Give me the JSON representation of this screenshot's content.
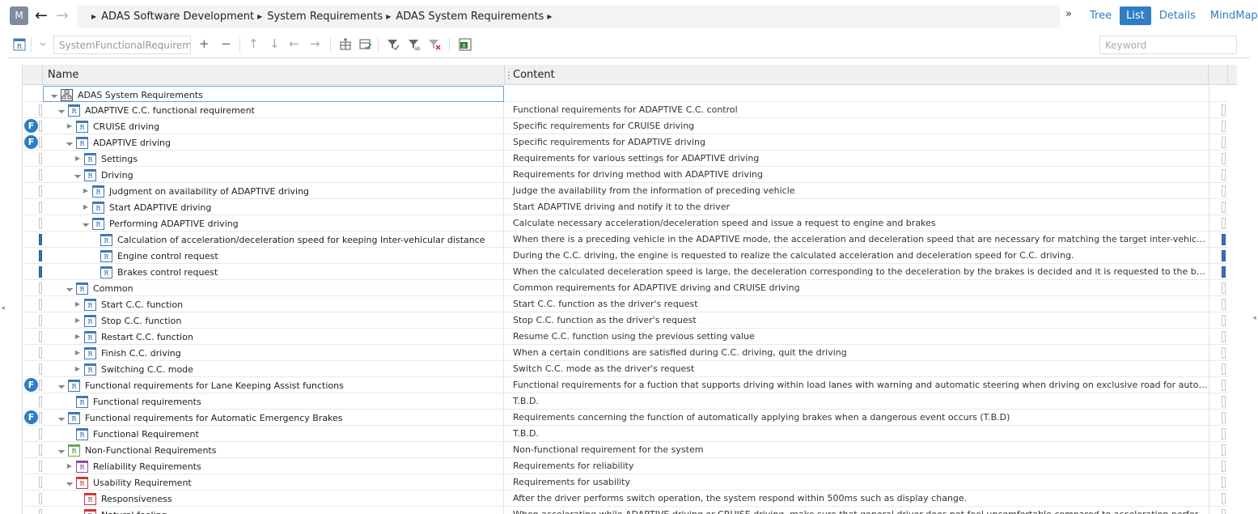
{
  "user": {
    "initial": "M"
  },
  "breadcrumb": [
    "ADAS Software Development",
    "System Requirements",
    "ADAS System Requirements"
  ],
  "more_label": "»",
  "view_tabs": [
    {
      "label": "Tree",
      "active": false
    },
    {
      "label": "List",
      "active": true
    },
    {
      "label": "Details",
      "active": false
    },
    {
      "label": "MindMap",
      "active": false
    }
  ],
  "toolbar": {
    "type_value": "SystemFunctionalRequirement",
    "keyword_placeholder": "Keyword",
    "add_label": "+",
    "remove_label": "−",
    "up_label": "↑",
    "down_label": "↓",
    "left_label": "←",
    "right_label": "→"
  },
  "columns": {
    "name": "Name",
    "content": "Content"
  },
  "accent_color": "#2f7ec4",
  "rows": [
    {
      "name": "ADAS System Requirements",
      "content": "",
      "indent": 0,
      "toggle": "open",
      "icon": "root",
      "flag": "",
      "mark": false,
      "endmark": false,
      "root": true
    },
    {
      "name": "ADAPTIVE C.C. functional requirement",
      "content": "Functional requirements for ADAPTIVE C.C. control",
      "indent": 1,
      "toggle": "open",
      "icon": "blue",
      "flag": "",
      "mark": false,
      "endmark": false
    },
    {
      "name": "CRUISE driving",
      "content": "Specific requirements for CRUISE driving",
      "indent": 2,
      "toggle": "closed",
      "icon": "blue",
      "flag": "F",
      "mark": false,
      "endmark": false
    },
    {
      "name": "ADAPTIVE driving",
      "content": "Specific requirements for ADAPTIVE driving",
      "indent": 2,
      "toggle": "open",
      "icon": "blue",
      "flag": "F",
      "mark": false,
      "endmark": false
    },
    {
      "name": "Settings",
      "content": "Requirements for various settings for ADAPTIVE driving",
      "indent": 3,
      "toggle": "closed",
      "icon": "blue",
      "flag": "",
      "mark": false,
      "endmark": false
    },
    {
      "name": "Driving",
      "content": "Requirements for driving method with ADAPTIVE driving",
      "indent": 3,
      "toggle": "open",
      "icon": "blue",
      "flag": "",
      "mark": false,
      "endmark": false
    },
    {
      "name": "Judgment on availability of ADAPTIVE driving",
      "content": "Judge the availability from the information of preceding vehicle",
      "indent": 4,
      "toggle": "closed",
      "icon": "blue",
      "flag": "",
      "mark": false,
      "endmark": false
    },
    {
      "name": "Start ADAPTIVE driving",
      "content": "Start ADAPTIVE driving and notify it to the driver",
      "indent": 4,
      "toggle": "closed",
      "icon": "blue",
      "flag": "",
      "mark": false,
      "endmark": false
    },
    {
      "name": "Performing ADAPTIVE driving",
      "content": "Calculate necessary acceleration/deceleration speed and issue a request to engine and brakes",
      "indent": 4,
      "toggle": "open",
      "icon": "blue",
      "flag": "",
      "mark": false,
      "endmark": false
    },
    {
      "name": "Calculation of acceleration/deceleration speed for keeping Inter-vehicular distance",
      "content": "When there is a preceding vehicle in the ADAPTIVE mode, the acceleration and deceleration speed that are necessary for matching the target inter-vehicular distance are calculated.",
      "indent": 5,
      "toggle": "none",
      "icon": "blue",
      "flag": "",
      "mark": true,
      "endmark": true
    },
    {
      "name": "Engine control request",
      "content": "During the C.C. driving, the engine is requested to realize the calculated acceleration and deceleration speed for C.C. driving.",
      "indent": 5,
      "toggle": "none",
      "icon": "blue",
      "flag": "",
      "mark": true,
      "endmark": true
    },
    {
      "name": "Brakes control request",
      "content": "When the calculated deceleration speed is large, the deceleration corresponding to the deceleration by the brakes is decided and it is requested to the brake controller.",
      "indent": 5,
      "toggle": "none",
      "icon": "blue",
      "flag": "",
      "mark": true,
      "endmark": true
    },
    {
      "name": "Common",
      "content": "Common requirements for ADAPTIVE driving and CRUISE driving",
      "indent": 2,
      "toggle": "open",
      "icon": "blue",
      "flag": "",
      "mark": false,
      "endmark": false
    },
    {
      "name": "Start C.C. function",
      "content": "Start C.C. function as the driver's request",
      "indent": 3,
      "toggle": "closed",
      "icon": "blue",
      "flag": "",
      "mark": false,
      "endmark": false
    },
    {
      "name": "Stop C.C. function",
      "content": "Stop C.C. function as the driver's request",
      "indent": 3,
      "toggle": "closed",
      "icon": "blue",
      "flag": "",
      "mark": false,
      "endmark": false
    },
    {
      "name": "Restart C.C. function",
      "content": "Resume C.C. function using the previous setting value",
      "indent": 3,
      "toggle": "closed",
      "icon": "blue",
      "flag": "",
      "mark": false,
      "endmark": false
    },
    {
      "name": "Finish C.C. driving",
      "content": "When a certain conditions are satisfied during C.C. driving, quit the driving",
      "indent": 3,
      "toggle": "closed",
      "icon": "blue",
      "flag": "",
      "mark": false,
      "endmark": false
    },
    {
      "name": "Switching C.C. mode",
      "content": "Switch C.C. mode as the driver's request",
      "indent": 3,
      "toggle": "closed",
      "icon": "blue",
      "flag": "",
      "mark": false,
      "endmark": false
    },
    {
      "name": "Functional requirements for Lane Keeping Assist functions",
      "content": "Functional requirements for a fuction that supports driving within load lanes with warning and automatic steering when driving on exclusive road for automobile (T.B.D)",
      "indent": 1,
      "toggle": "open",
      "icon": "blue",
      "flag": "F",
      "mark": false,
      "endmark": false
    },
    {
      "name": "Functional requirements",
      "content": "T.B.D.",
      "indent": 2,
      "toggle": "none",
      "icon": "blue",
      "flag": "",
      "mark": false,
      "endmark": false
    },
    {
      "name": "Functional requirements for Automatic Emergency Brakes",
      "content": "Requirements concerning the function of automatically applying brakes when a dangerous event occurs (T.B.D)",
      "indent": 1,
      "toggle": "open",
      "icon": "blue",
      "flag": "F",
      "mark": false,
      "endmark": false
    },
    {
      "name": "Functional Requirement",
      "content": "T.B.D.",
      "indent": 2,
      "toggle": "none",
      "icon": "blue",
      "flag": "",
      "mark": false,
      "endmark": false
    },
    {
      "name": "Non-Functional Requirements",
      "content": "Non-functional requirement for the system",
      "indent": 1,
      "toggle": "open",
      "icon": "green",
      "flag": "",
      "mark": false,
      "endmark": false
    },
    {
      "name": "Reliability Requirements",
      "content": "Requirements for reliability",
      "indent": 2,
      "toggle": "closed",
      "icon": "purple",
      "flag": "",
      "mark": false,
      "endmark": false
    },
    {
      "name": "Usability Requirement",
      "content": "Requirements for usability",
      "indent": 2,
      "toggle": "open",
      "icon": "red",
      "flag": "",
      "mark": false,
      "endmark": false
    },
    {
      "name": "Responsiveness",
      "content": "After the driver performs switch operation, the system respond within 500ms such as display change.",
      "indent": 3,
      "toggle": "none",
      "icon": "red",
      "flag": "",
      "mark": false,
      "endmark": false
    },
    {
      "name": "Natural feeling",
      "content": "When accelerating while ADAPTIVE driving or CRUISE driving, make sure that general driver does not feel uncomfortable compared to acceleration performed by",
      "indent": 3,
      "toggle": "none",
      "icon": "red",
      "flag": "",
      "mark": false,
      "endmark": false
    }
  ]
}
